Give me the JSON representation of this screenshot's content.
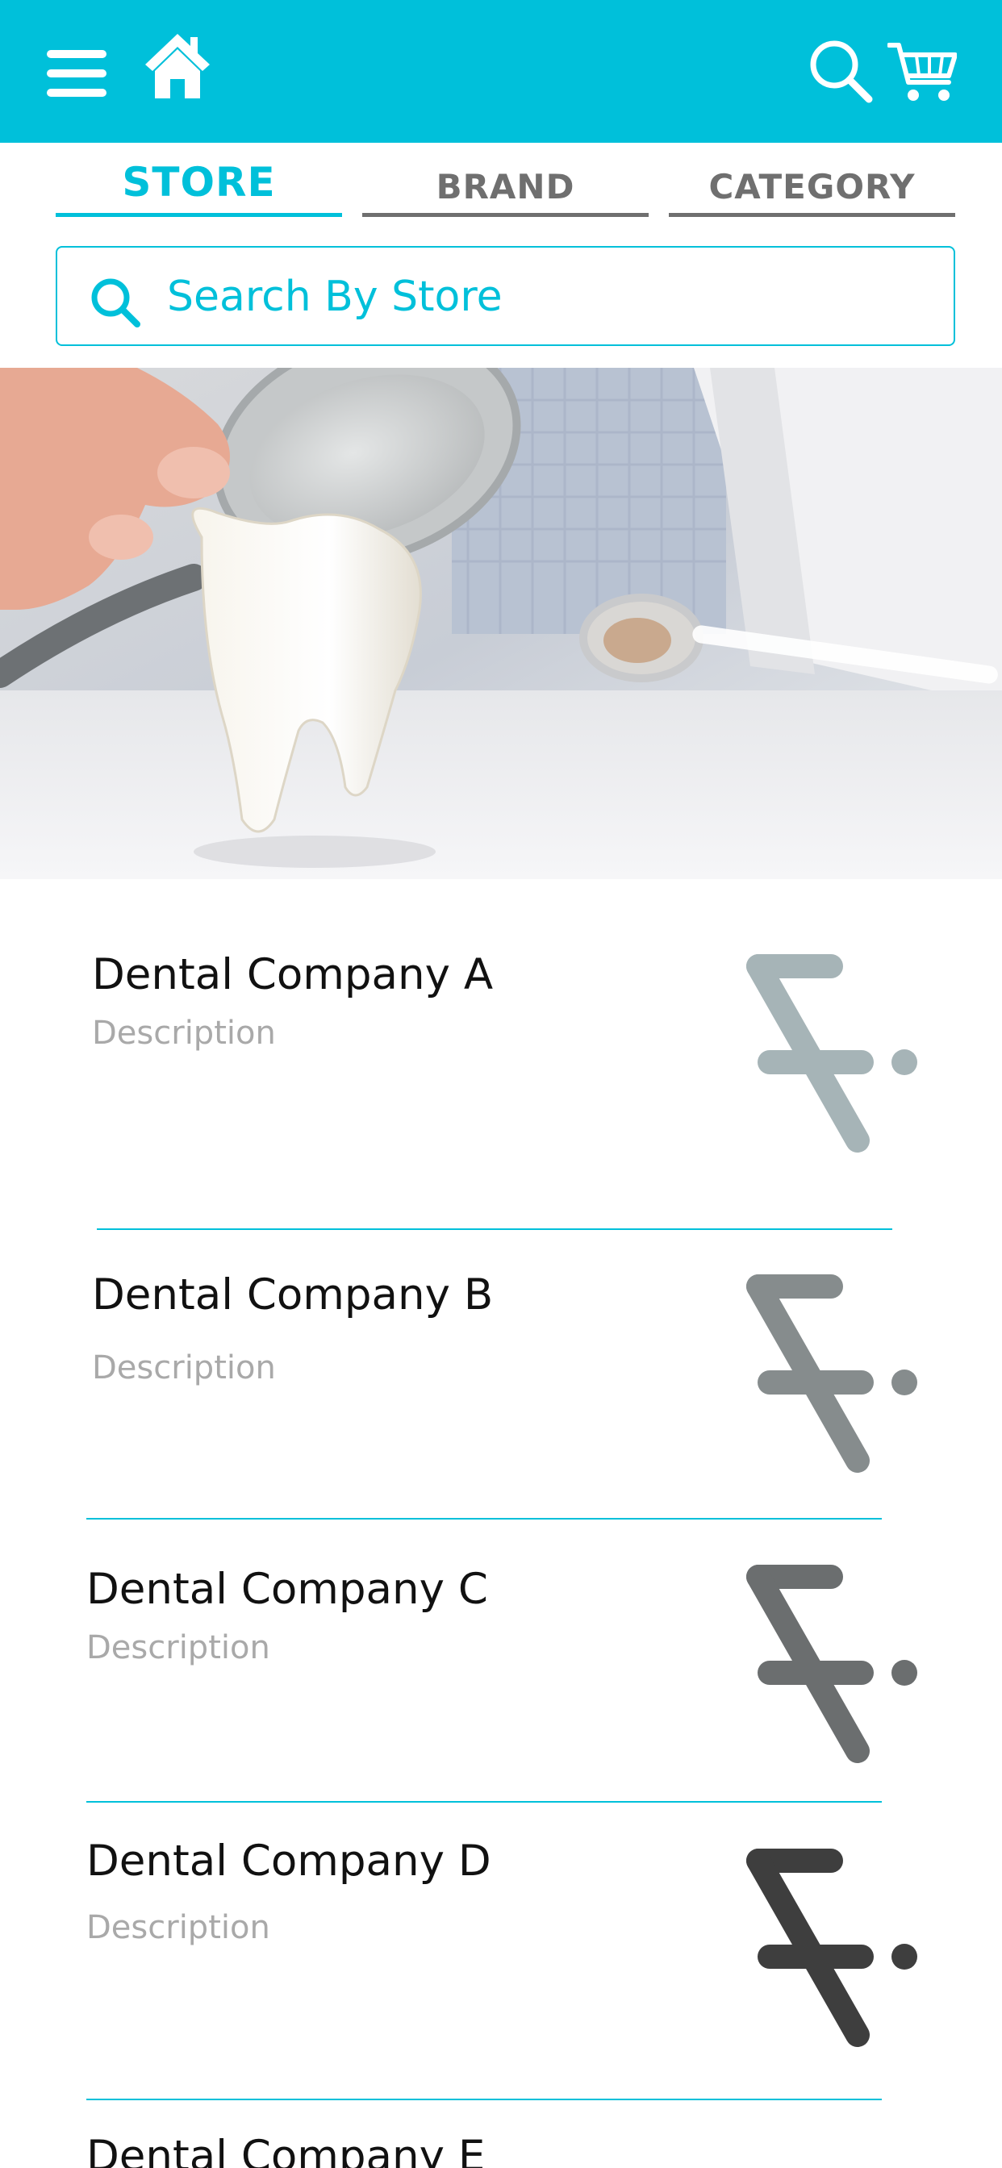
{
  "header": {
    "menu_icon": "hamburger-icon",
    "home_icon": "home-icon",
    "search_icon": "search-icon",
    "cart_icon": "cart-icon",
    "background_color": "#00C0DA"
  },
  "tabs": [
    {
      "label": "STORE",
      "active": true
    },
    {
      "label": "BRAND",
      "active": false
    },
    {
      "label": "CATEGORY",
      "active": false
    }
  ],
  "search": {
    "placeholder": "Search By Store",
    "value": "",
    "icon": "search-icon"
  },
  "hero": {
    "icon": "dental-banner-image"
  },
  "stores": [
    {
      "name": "Dental Company A",
      "description": "Description",
      "logo_color": "#A6B4B7"
    },
    {
      "name": "Dental Company B",
      "description": "Description",
      "logo_color": "#868C8D"
    },
    {
      "name": "Dental Company C",
      "description": "Description",
      "logo_color": "#6B6E6F"
    },
    {
      "name": "Dental Company D",
      "description": "Description",
      "logo_color": "#3E3E3E"
    },
    {
      "name": "Dental Company E"
    }
  ],
  "colors": {
    "accent": "#00C0DA",
    "inactive_tab": "#6f6f6f",
    "description": "#a9a9a9"
  }
}
